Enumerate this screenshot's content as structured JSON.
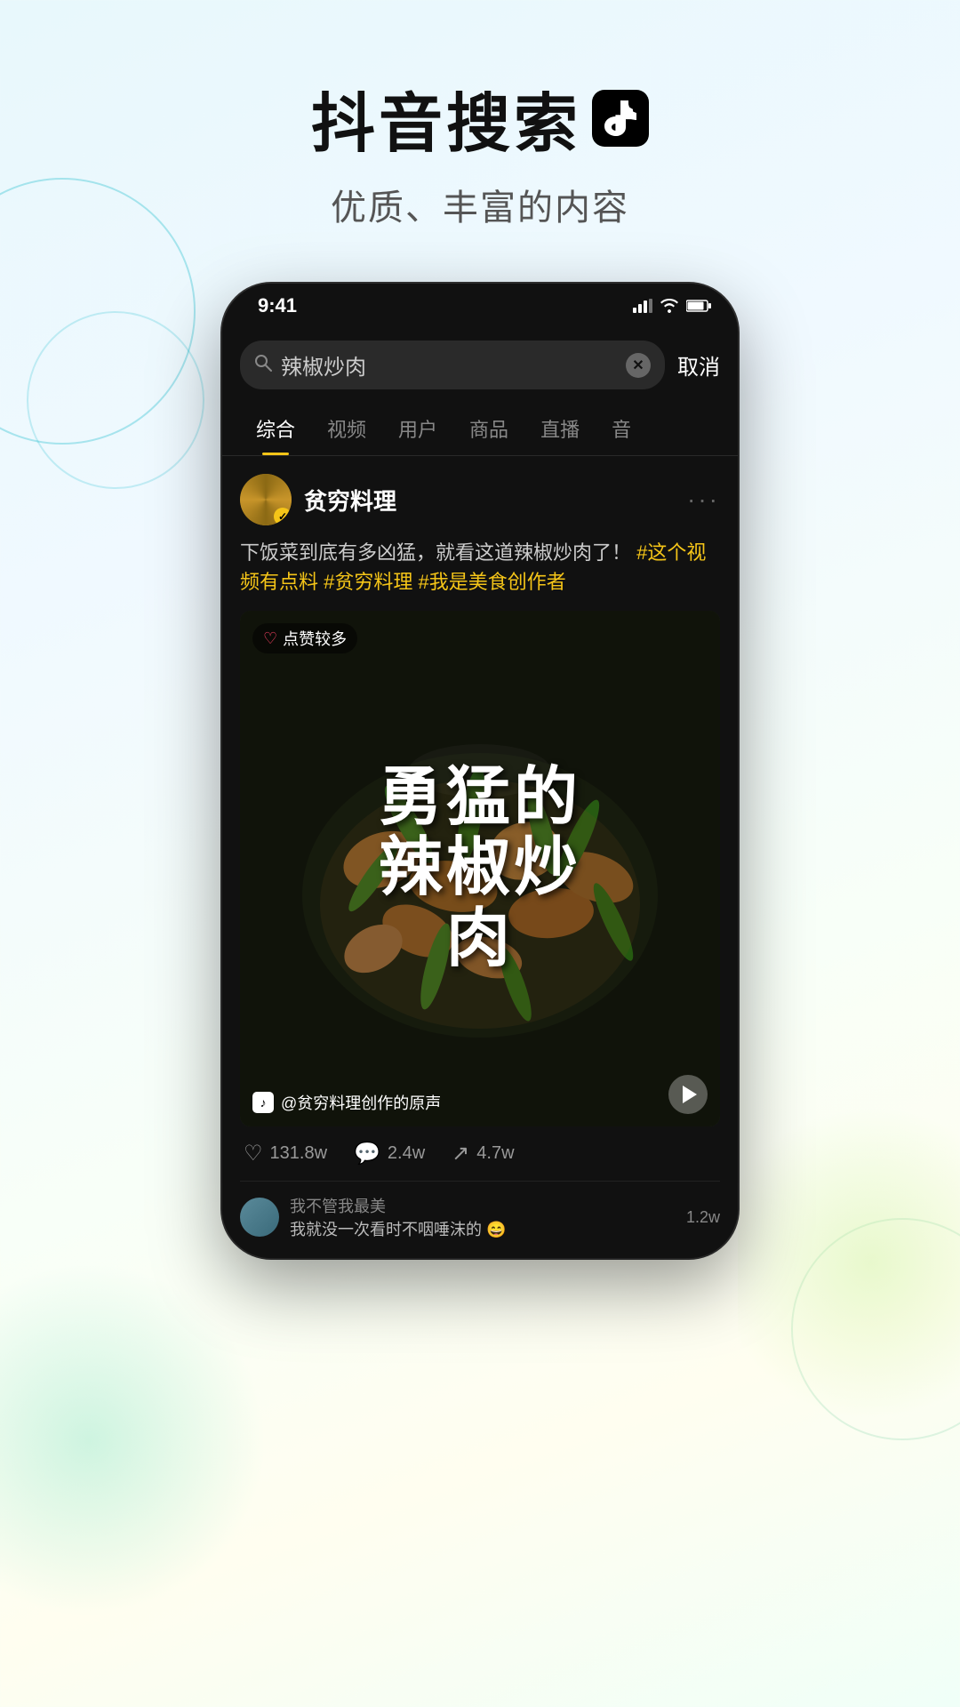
{
  "page": {
    "background": "gradient"
  },
  "header": {
    "title": "抖音搜索",
    "logo_alt": "tiktok-logo",
    "subtitle": "优质、丰富的内容"
  },
  "phone": {
    "status_bar": {
      "time": "9:41"
    },
    "search": {
      "placeholder": "辣椒炒肉",
      "cancel_label": "取消"
    },
    "tabs": [
      {
        "label": "综合",
        "active": true
      },
      {
        "label": "视频",
        "active": false
      },
      {
        "label": "用户",
        "active": false
      },
      {
        "label": "商品",
        "active": false
      },
      {
        "label": "直播",
        "active": false
      },
      {
        "label": "音",
        "active": false
      }
    ],
    "post": {
      "user": {
        "name": "贫穷料理",
        "verified": true
      },
      "description": "下饭菜到底有多凶猛，就看这道辣椒炒肉了！",
      "hashtags": [
        "#这个视频有点料",
        "#贫穷料理",
        "#我是美食创作者"
      ],
      "video": {
        "hot_badge": "点赞较多",
        "title_line1": "勇",
        "title_line2": "猛的",
        "title_line3": "辣椒炒",
        "title_line4": "肉",
        "title_full": "勇猛的辣椒炒肉",
        "audio_text": "@贫穷料理创作的原声"
      },
      "stats": {
        "likes": "131.8w",
        "comments": "2.4w",
        "shares": "4.7w"
      },
      "comment_preview": {
        "user": "我不管我最美",
        "text": "我就没一次看时不咽唾沫的 😄",
        "count": "1.2w"
      }
    }
  }
}
